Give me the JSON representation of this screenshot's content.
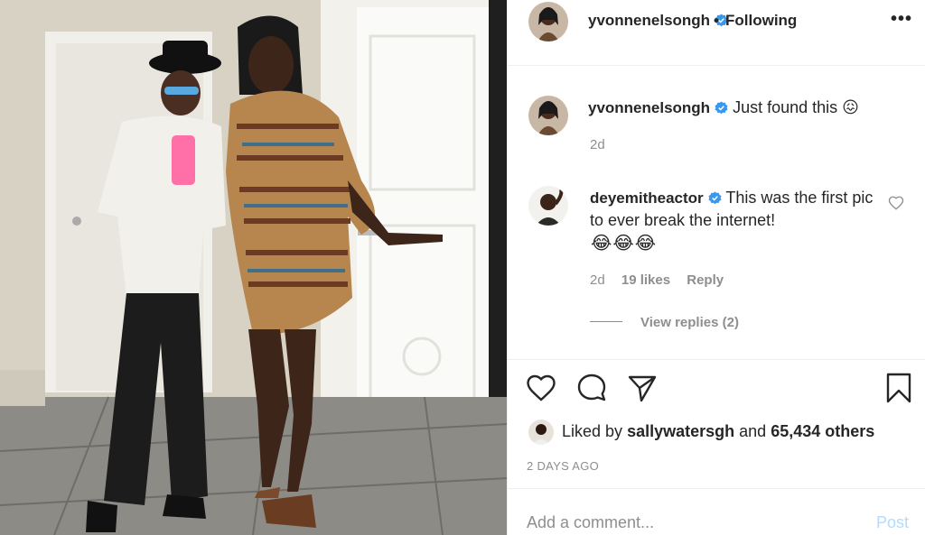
{
  "post": {
    "author": "yvonnenelsongh",
    "separator": "•",
    "follow_status": "Following",
    "more": "•••"
  },
  "caption": {
    "username": "yvonnenelsongh",
    "text": "Just found this 😖",
    "time": "2d"
  },
  "comment": {
    "username": "deyemitheactor",
    "text": "This was the first pic to ever break the internet!",
    "emoji": "😂😂😂",
    "time": "2d",
    "likes": "19 likes",
    "reply_label": "Reply",
    "view_replies": "View replies (2)"
  },
  "likes": {
    "prefix": "Liked by",
    "user": "sallywatersgh",
    "middle": "and",
    "count": "65,434 others"
  },
  "date": "2 DAYS AGO",
  "add_comment": {
    "placeholder": "Add a comment...",
    "post_label": "Post"
  },
  "icons": {
    "like": "heart-icon",
    "comment": "speech-bubble-icon",
    "share": "paper-plane-icon",
    "save": "bookmark-icon",
    "verified": "verified-badge-icon"
  },
  "colors": {
    "verified": "#3897f0",
    "post_disabled": "#b3dbff",
    "muted": "#8e8e8e",
    "text": "#262626"
  }
}
